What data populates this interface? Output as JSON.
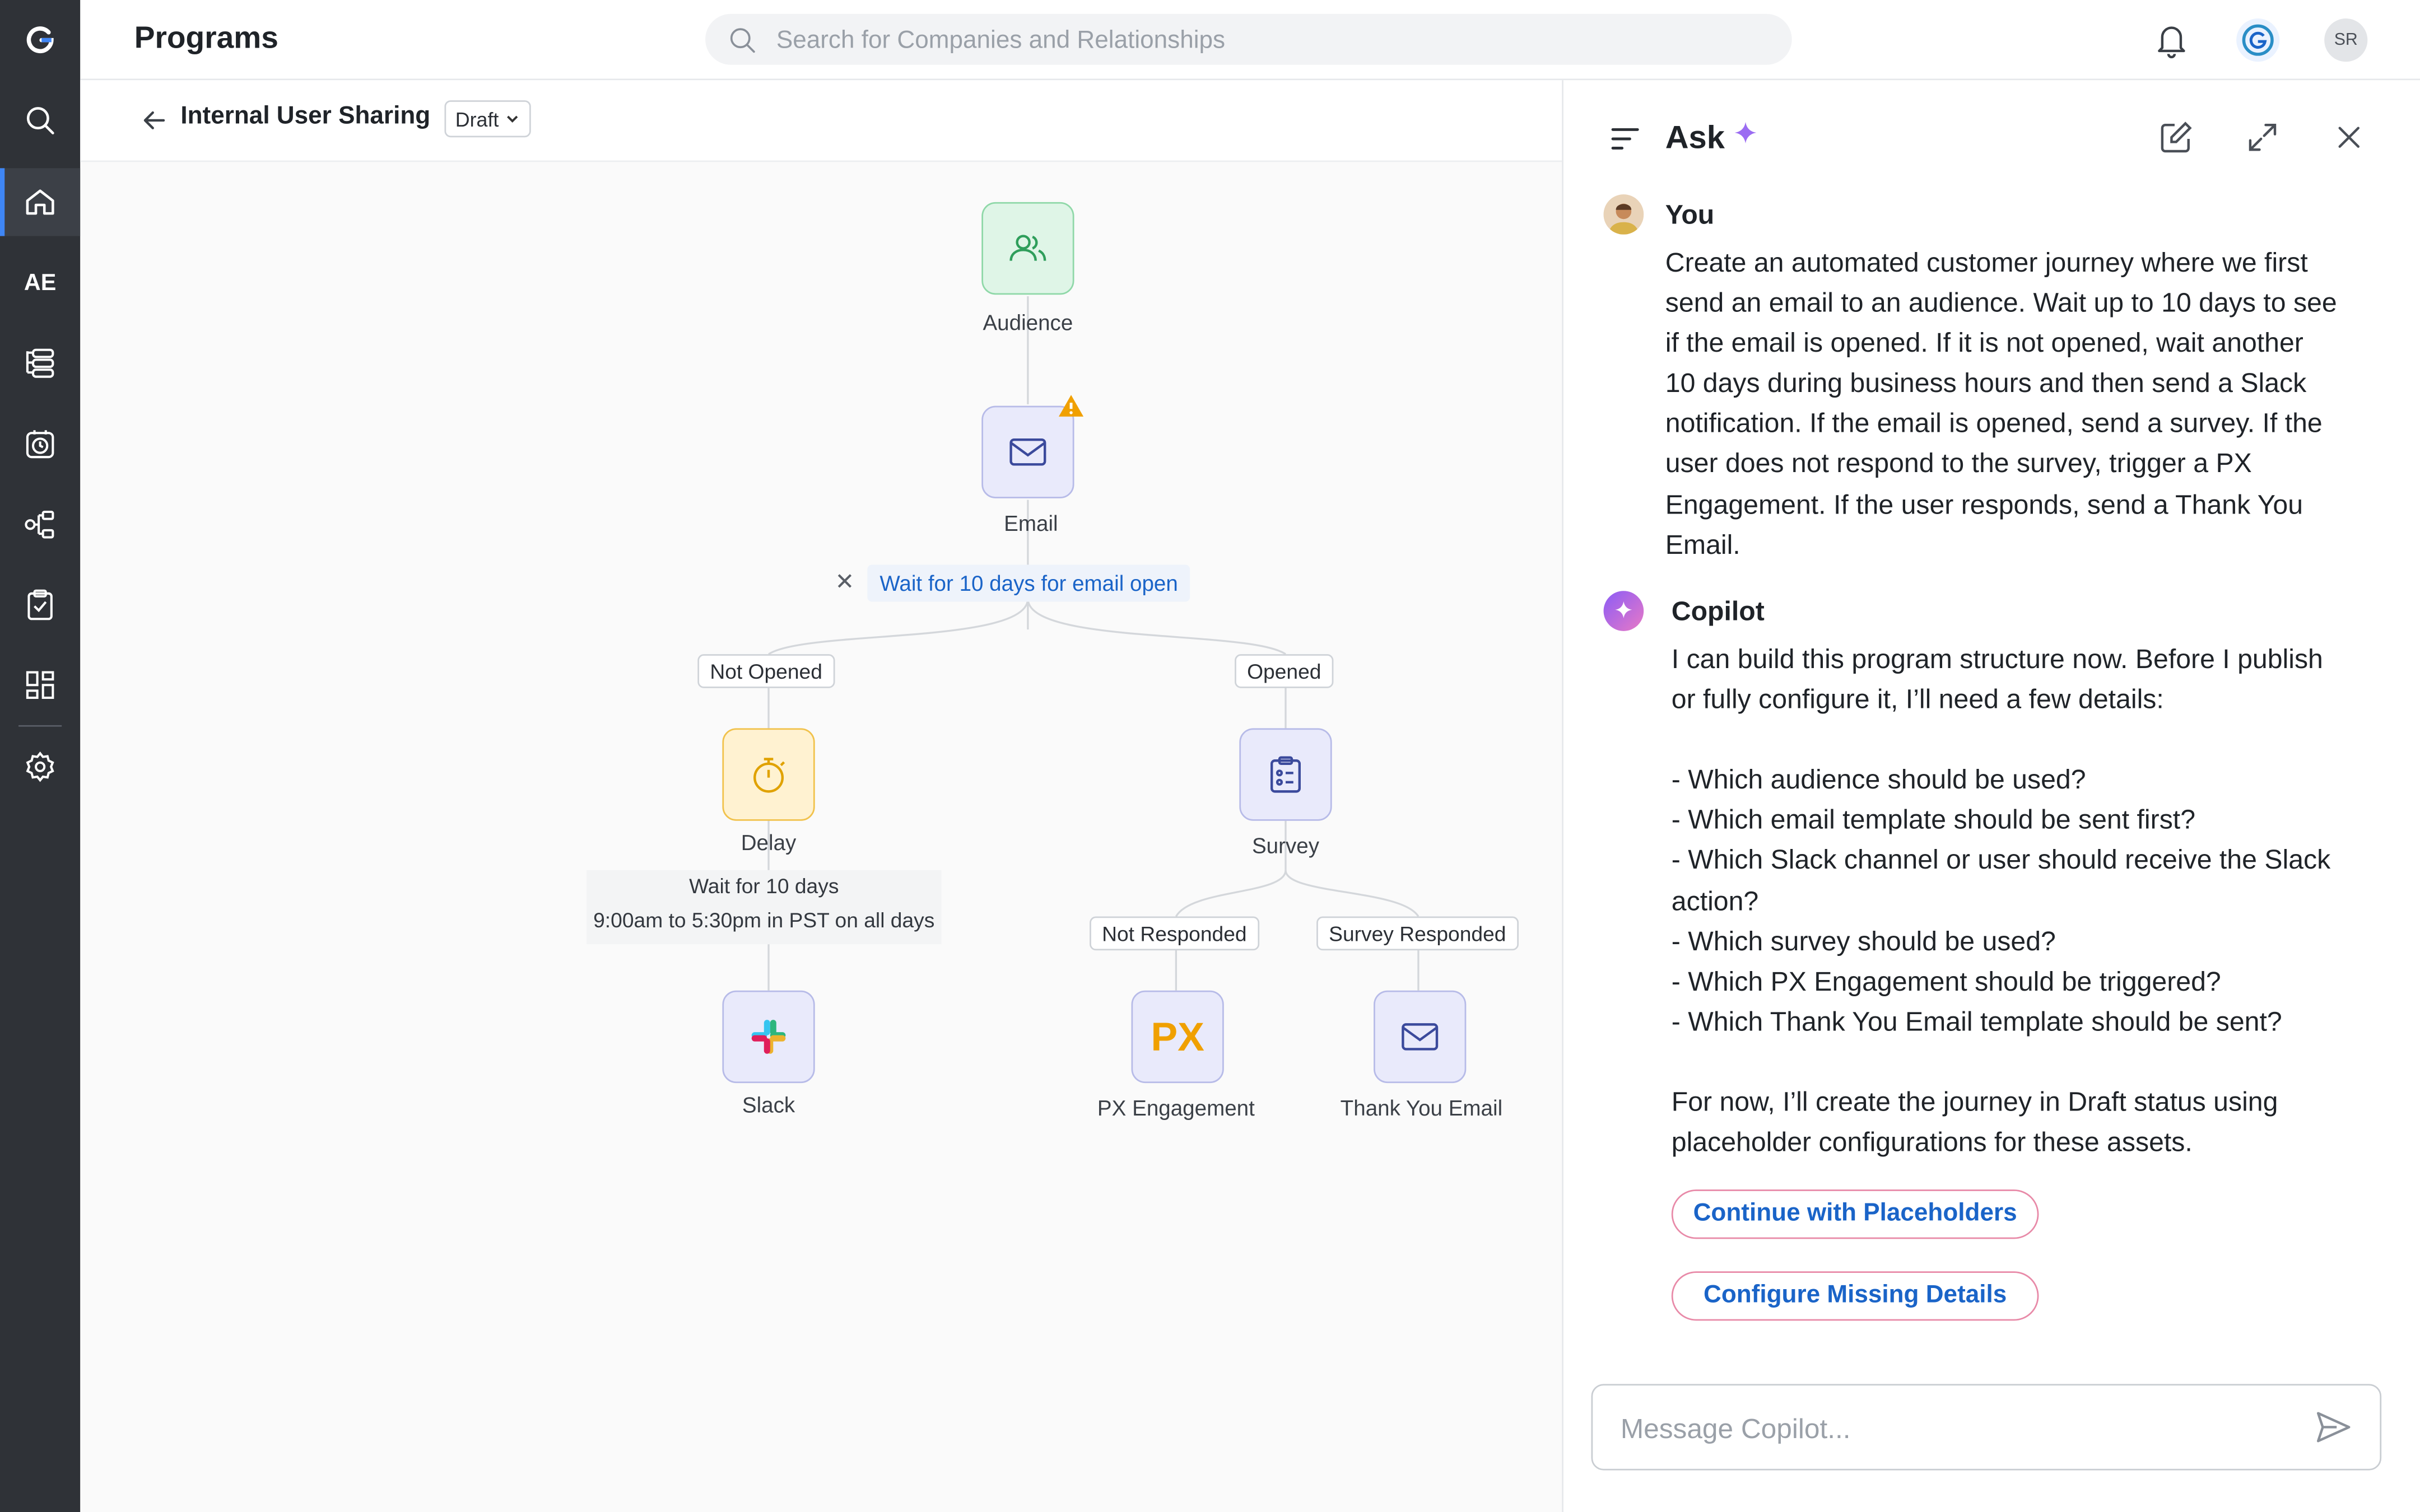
{
  "app": {
    "title": "Programs",
    "logo": "G"
  },
  "search": {
    "placeholder": "Search for Companies and Relationships"
  },
  "header": {
    "user_initials": "SR",
    "avatar_letter": "G"
  },
  "rail": {
    "ae_label": "AE",
    "icons": [
      "search-icon",
      "home-icon",
      "ae-label",
      "list-icon",
      "calendar-clock-icon",
      "workflow-icon",
      "clipboard-check-icon",
      "dashboard-icon",
      "gear-icon"
    ]
  },
  "program": {
    "name": "Internal User Sharing",
    "status": "Draft"
  },
  "flow": {
    "audience": "Audience",
    "email": "Email",
    "wait_condition": "Wait for 10 days for email open",
    "not_opened": "Not Opened",
    "opened": "Opened",
    "delay": "Delay",
    "delay_detail_1": "Wait for 10 days",
    "delay_detail_2": "9:00am to 5:30pm in PST on all days",
    "slack": "Slack",
    "survey": "Survey",
    "not_responded": "Not Responded",
    "survey_responded": "Survey Responded",
    "px_engagement": "PX Engagement",
    "px_icon_text": "PX",
    "thank_you_email": "Thank You Email",
    "colors": {
      "green": "#dff5e7",
      "purple": "#e9eafb",
      "yellow": "#fff2d1",
      "warning": "#f0a000",
      "link": "#1a64c8"
    }
  },
  "panel": {
    "title": "Ask",
    "user_name": "You",
    "user_message_lines": [
      "Create an automated customer journey where we first",
      "send an email to an audience. Wait up to 10 days to see",
      "if the email is opened. If it is not opened, wait another",
      "10 days during business hours and then send a Slack",
      "notification. If the email is opened, send a survey. If the",
      "user does not respond to the survey, trigger a PX",
      "Engagement. If the user responds, send a Thank You",
      "Email."
    ],
    "bot_name": "Copilot",
    "bot_message_lines": [
      "I can build this program structure now. Before I publish",
      "or fully configure it, I’ll need a few details:",
      "",
      "- Which audience should be used?",
      "- Which email template should be sent first?",
      "- Which Slack channel or user should receive the Slack",
      "action?",
      "- Which survey should be used?",
      "- Which PX Engagement should be triggered?",
      "- Which Thank You Email template should be sent?",
      "",
      "For now, I’ll create the journey in Draft status using",
      "placeholder configurations for these assets."
    ],
    "button_continue": "Continue with Placeholders",
    "button_configure": "Configure Missing Details",
    "composer_placeholder": "Message Copilot..."
  }
}
